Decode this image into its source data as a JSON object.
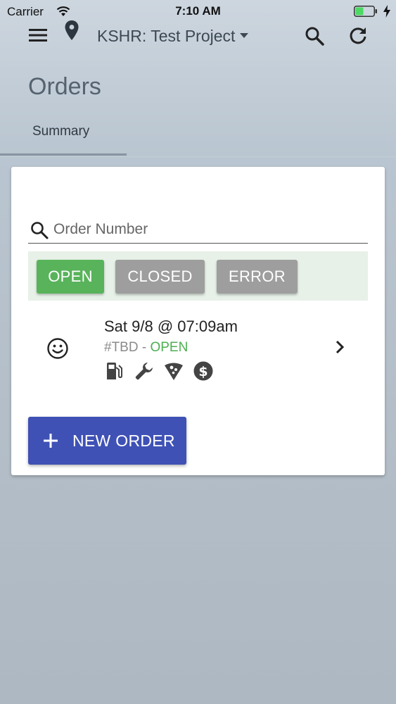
{
  "status_bar": {
    "carrier": "Carrier",
    "time": "7:10 AM",
    "icons": [
      "wifi-icon",
      "battery-icon",
      "charging-icon"
    ],
    "battery_color": "#4cd964"
  },
  "toolbar": {
    "project_label": "KSHR: Test Project",
    "icons": [
      "menu-icon",
      "location-pin-icon",
      "caret-down-icon",
      "search-icon",
      "refresh-icon"
    ]
  },
  "page": {
    "title": "Orders",
    "tabs": [
      {
        "label": "Summary",
        "active": true
      }
    ]
  },
  "search": {
    "placeholder": "Order Number",
    "value": ""
  },
  "filters": {
    "open_label": "OPEN",
    "closed_label": "CLOSED",
    "error_label": "ERROR",
    "active": "OPEN",
    "active_color": "#58b35b",
    "inactive_color": "#9e9e9e"
  },
  "orders": [
    {
      "date": "Sat 9/8 @ 07:09am",
      "number": "#TBD",
      "separator": " - ",
      "status": "OPEN",
      "status_color": "#4caf50",
      "icons": [
        "smiley-icon",
        "fuel-pump-icon",
        "wrench-icon",
        "pizza-icon",
        "dollar-icon",
        "chevron-right-icon"
      ]
    }
  ],
  "actions": {
    "new_order_label": "NEW ORDER",
    "new_order_color": "#3f51b5"
  }
}
